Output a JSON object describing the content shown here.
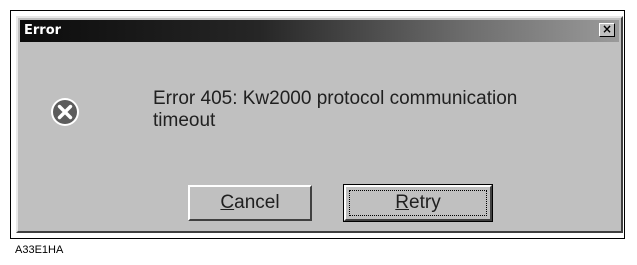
{
  "window": {
    "title": "Error",
    "close_glyph": "×"
  },
  "icon": "error-icon",
  "message": "Error 405: Kw2000 protocol communication timeout",
  "buttons": {
    "cancel": {
      "mnemonic": "C",
      "rest": "ancel"
    },
    "retry": {
      "mnemonic": "R",
      "rest": "etry"
    }
  },
  "caption": "A33E1HA",
  "colors": {
    "dialog_bg": "#c0c0c0",
    "titlebar": "#0c0c0c",
    "icon": "#606060"
  }
}
